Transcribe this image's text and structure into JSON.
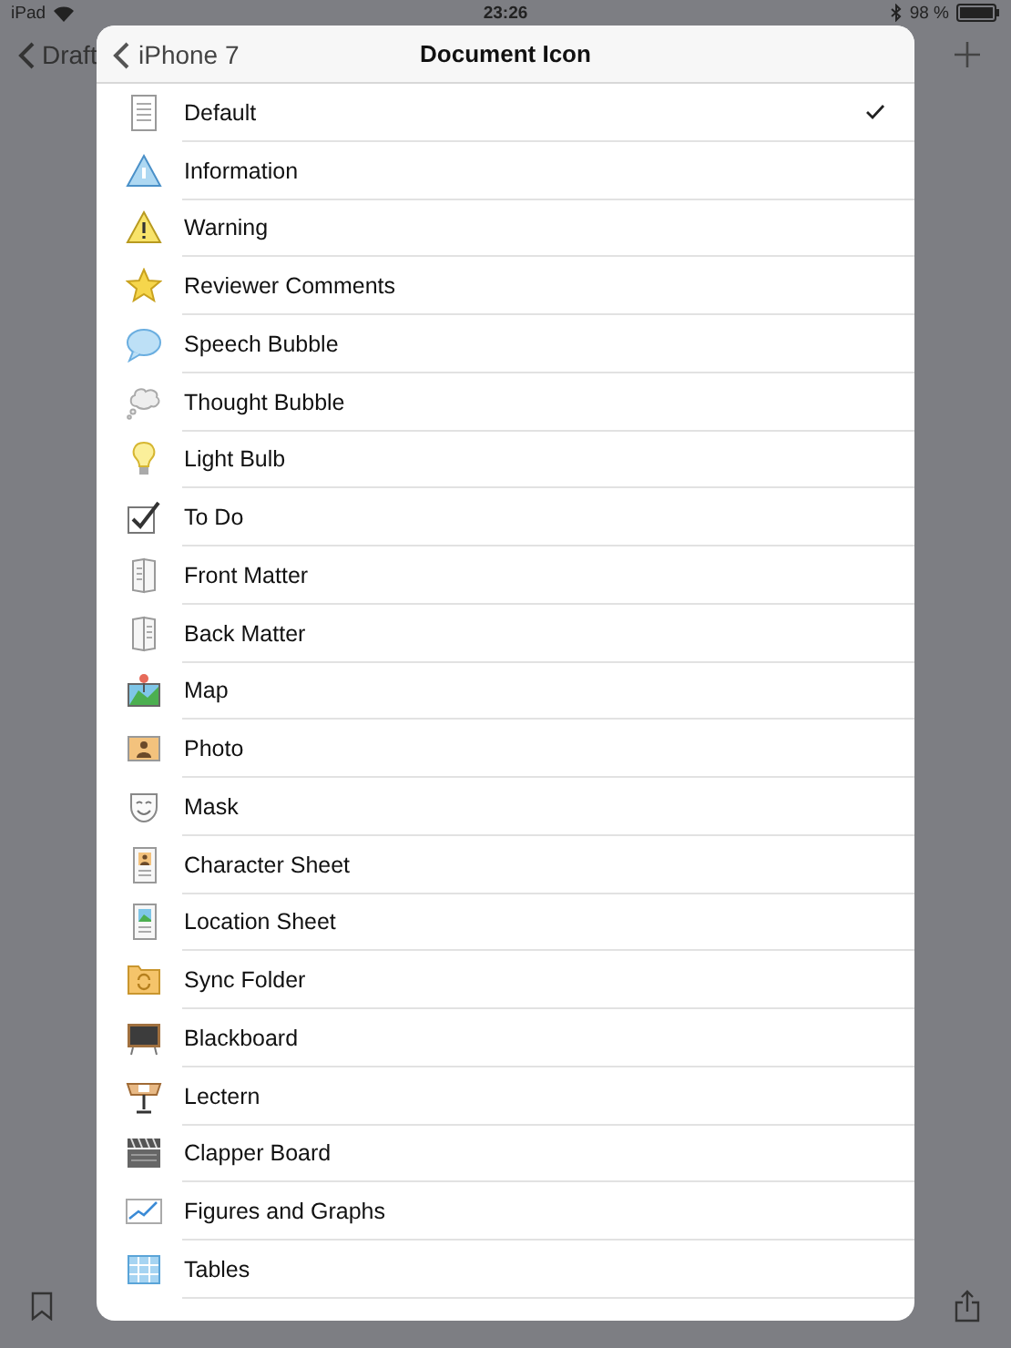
{
  "status_bar": {
    "device": "iPad",
    "time": "23:26",
    "battery": "98 %"
  },
  "background_nav": {
    "back_label": "Draft"
  },
  "sheet": {
    "back_label": "iPhone 7",
    "title": "Document Icon",
    "items": [
      {
        "label": "Default",
        "kind": "default",
        "selected": true
      },
      {
        "label": "Information",
        "kind": "information",
        "selected": false
      },
      {
        "label": "Warning",
        "kind": "warning",
        "selected": false
      },
      {
        "label": "Reviewer Comments",
        "kind": "star",
        "selected": false
      },
      {
        "label": "Speech Bubble",
        "kind": "speech",
        "selected": false
      },
      {
        "label": "Thought Bubble",
        "kind": "thought",
        "selected": false
      },
      {
        "label": "Light Bulb",
        "kind": "bulb",
        "selected": false
      },
      {
        "label": "To Do",
        "kind": "todo",
        "selected": false
      },
      {
        "label": "Front Matter",
        "kind": "front",
        "selected": false
      },
      {
        "label": "Back Matter",
        "kind": "back",
        "selected": false
      },
      {
        "label": "Map",
        "kind": "map",
        "selected": false
      },
      {
        "label": "Photo",
        "kind": "photo",
        "selected": false
      },
      {
        "label": "Mask",
        "kind": "mask",
        "selected": false
      },
      {
        "label": "Character Sheet",
        "kind": "character",
        "selected": false
      },
      {
        "label": "Location Sheet",
        "kind": "location",
        "selected": false
      },
      {
        "label": "Sync Folder",
        "kind": "folder",
        "selected": false
      },
      {
        "label": "Blackboard",
        "kind": "blackboard",
        "selected": false
      },
      {
        "label": "Lectern",
        "kind": "lectern",
        "selected": false
      },
      {
        "label": "Clapper Board",
        "kind": "clapper",
        "selected": false
      },
      {
        "label": "Figures and Graphs",
        "kind": "graph",
        "selected": false
      },
      {
        "label": "Tables",
        "kind": "tables",
        "selected": false
      }
    ]
  }
}
